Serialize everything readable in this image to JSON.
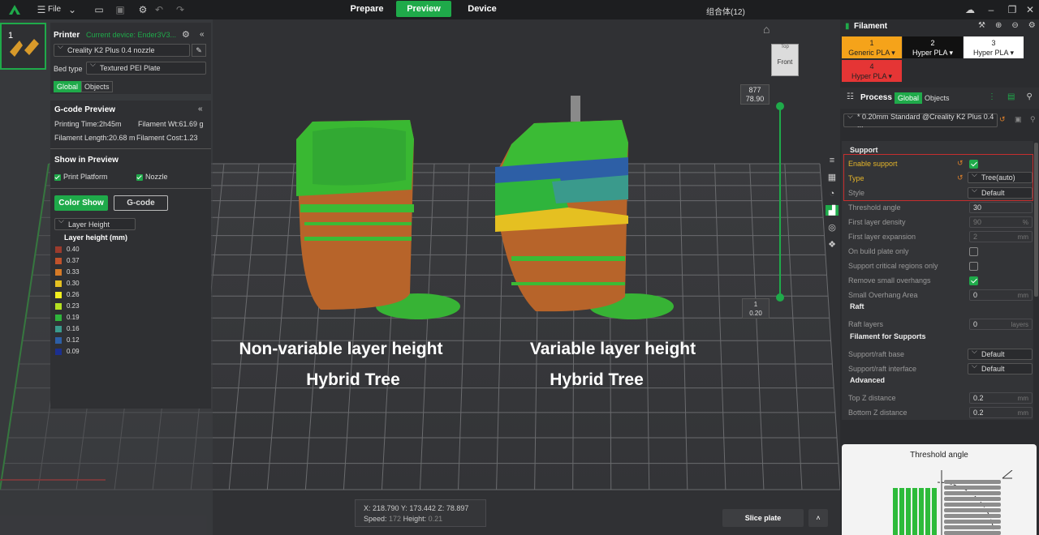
{
  "topbar": {
    "file_label": "File",
    "tabs": [
      "Prepare",
      "Preview",
      "Device"
    ],
    "active_tab": "Preview",
    "project_name": "组合体(12)"
  },
  "plate": {
    "number": "1"
  },
  "printer": {
    "title": "Printer",
    "current_device": "Current device: Ender3V3...",
    "printer_name": "Creality K2 Plus 0.4 nozzle",
    "bed_type_label": "Bed type",
    "bed_type_value": "Textured PEI Plate",
    "scope": [
      "Global",
      "Objects"
    ]
  },
  "gcode_preview": {
    "title": "G-code Preview",
    "printing_time": "Printing Time:2h45m",
    "filament_wt": "Filament Wt:61.69 g",
    "filament_length": "Filament Length:20.68 m",
    "filament_cost": "Filament Cost:1.23",
    "show_in_preview": "Show in Preview",
    "print_platform": "Print Platform",
    "nozzle": "Nozzle",
    "color_show_btn": "Color Show",
    "gcode_btn": "G-code",
    "view_type": "Layer Height",
    "legend_title": "Layer height (mm)",
    "legend": [
      {
        "value": "0.40",
        "color": "#9b3b2c"
      },
      {
        "value": "0.37",
        "color": "#c0522b"
      },
      {
        "value": "0.33",
        "color": "#d67a27"
      },
      {
        "value": "0.30",
        "color": "#e5c021"
      },
      {
        "value": "0.26",
        "color": "#f2ef1f"
      },
      {
        "value": "0.23",
        "color": "#b4e021"
      },
      {
        "value": "0.19",
        "color": "#2fb43c"
      },
      {
        "value": "0.16",
        "color": "#3a9a8c"
      },
      {
        "value": "0.12",
        "color": "#2d5fa6"
      },
      {
        "value": "0.09",
        "color": "#1b2f8f"
      }
    ]
  },
  "viewport": {
    "caption_left_1": "Non-variable layer height",
    "caption_left_2": "Hybrid Tree",
    "caption_right_1": "Variable layer height",
    "caption_right_2": "Hybrid Tree",
    "cube_top": "Top",
    "cube_front": "Front",
    "slider_top_layer": "877",
    "slider_top_height": "78.90",
    "slider_bottom_layer": "1",
    "slider_bottom_height": "0.20",
    "coords": "X: 218.790  Y: 173.442  Z: 78.897",
    "speed_label": "Speed:",
    "speed_value": "172",
    "height_label": "Height:",
    "height_value": "0.21",
    "slice_btn": "Slice plate"
  },
  "filament": {
    "title": "Filament",
    "slots": [
      {
        "num": "1",
        "name": "Generic PLA",
        "color": "#f5a31a",
        "text": "#222"
      },
      {
        "num": "2",
        "name": "Hyper PLA",
        "color": "#111111",
        "text": "#fff"
      },
      {
        "num": "3",
        "name": "Hyper PLA",
        "color": "#ffffff",
        "text": "#222"
      },
      {
        "num": "4",
        "name": "Hyper PLA",
        "color": "#e53535",
        "text": "#222"
      }
    ]
  },
  "process": {
    "title": "Process",
    "scope": [
      "Global",
      "Objects"
    ],
    "preset": "* 0.20mm Standard @Creality K2 Plus 0.4 ...",
    "support_section": "Support",
    "enable_support": "Enable support",
    "type_label": "Type",
    "type_value": "Tree(auto)",
    "style_label": "Style",
    "style_value": "Default",
    "threshold_angle": "Threshold angle",
    "threshold_value": "30",
    "first_layer_density": "First layer density",
    "first_layer_density_value": "90",
    "first_layer_density_unit": "%",
    "first_layer_expansion": "First layer expansion",
    "first_layer_expansion_value": "2",
    "mm": "mm",
    "on_build_plate": "On build plate only",
    "critical_regions": "Support critical regions only",
    "remove_small": "Remove small overhangs",
    "small_overhang_area": "Small Overhang Area",
    "small_overhang_value": "0",
    "raft_section": "Raft",
    "raft_layers": "Raft layers",
    "raft_layers_value": "0",
    "layers_unit": "layers",
    "filament_supports_section": "Filament for Supports",
    "support_raft_base": "Support/raft base",
    "support_raft_interface": "Support/raft interface",
    "default": "Default",
    "advanced_section": "Advanced",
    "top_z": "Top Z distance",
    "top_z_value": "0.2",
    "bottom_z": "Bottom Z distance",
    "bottom_z_value": "0.2",
    "help_title": "Threshold angle"
  },
  "colors": {
    "accent": "#1faa4a",
    "highlight_box": "#c62e2e"
  }
}
